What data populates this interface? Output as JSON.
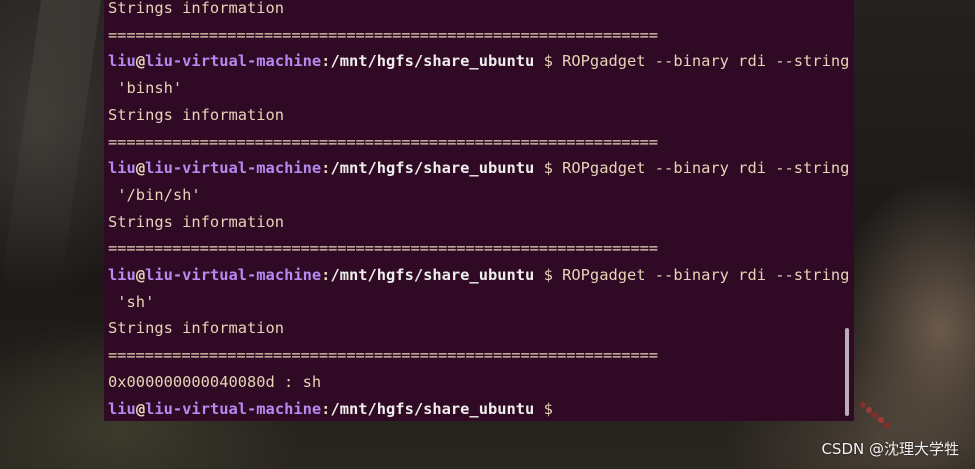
{
  "terminal": {
    "lines": [
      {
        "kind": "text",
        "text": "Strings information"
      },
      {
        "kind": "sep",
        "text": "============================================================"
      },
      {
        "kind": "prompt",
        "user": "liu",
        "at": "@",
        "host": "liu-virtual-machine",
        "colon": ":",
        "path": "/mnt/hgfs/share_ubuntu",
        "dollar": "$",
        "cmd": " ROPgadget --binary rdi --string"
      },
      {
        "kind": "text",
        "text": " 'binsh'"
      },
      {
        "kind": "text",
        "text": "Strings information"
      },
      {
        "kind": "sep",
        "text": "============================================================"
      },
      {
        "kind": "prompt",
        "user": "liu",
        "at": "@",
        "host": "liu-virtual-machine",
        "colon": ":",
        "path": "/mnt/hgfs/share_ubuntu",
        "dollar": "$",
        "cmd": " ROPgadget --binary rdi --string"
      },
      {
        "kind": "text",
        "text": " '/bin/sh'"
      },
      {
        "kind": "text",
        "text": "Strings information"
      },
      {
        "kind": "sep",
        "text": "============================================================"
      },
      {
        "kind": "prompt",
        "user": "liu",
        "at": "@",
        "host": "liu-virtual-machine",
        "colon": ":",
        "path": "/mnt/hgfs/share_ubuntu",
        "dollar": "$",
        "cmd": " ROPgadget --binary rdi --string"
      },
      {
        "kind": "text",
        "text": " 'sh'"
      },
      {
        "kind": "text",
        "text": "Strings information"
      },
      {
        "kind": "sep",
        "text": "============================================================"
      },
      {
        "kind": "text",
        "text": "0x000000000040080d : sh"
      },
      {
        "kind": "prompt",
        "user": "liu",
        "at": "@",
        "host": "liu-virtual-machine",
        "colon": ":",
        "path": "/mnt/hgfs/share_ubuntu",
        "dollar": "$",
        "cmd": ""
      }
    ]
  },
  "watermark": {
    "text": "CSDN @沈理大学牲"
  },
  "colors": {
    "terminal_bg": "#300a24",
    "text": "#e6d4b8",
    "user_host": "#b58af0",
    "path": "#eeeeec"
  }
}
